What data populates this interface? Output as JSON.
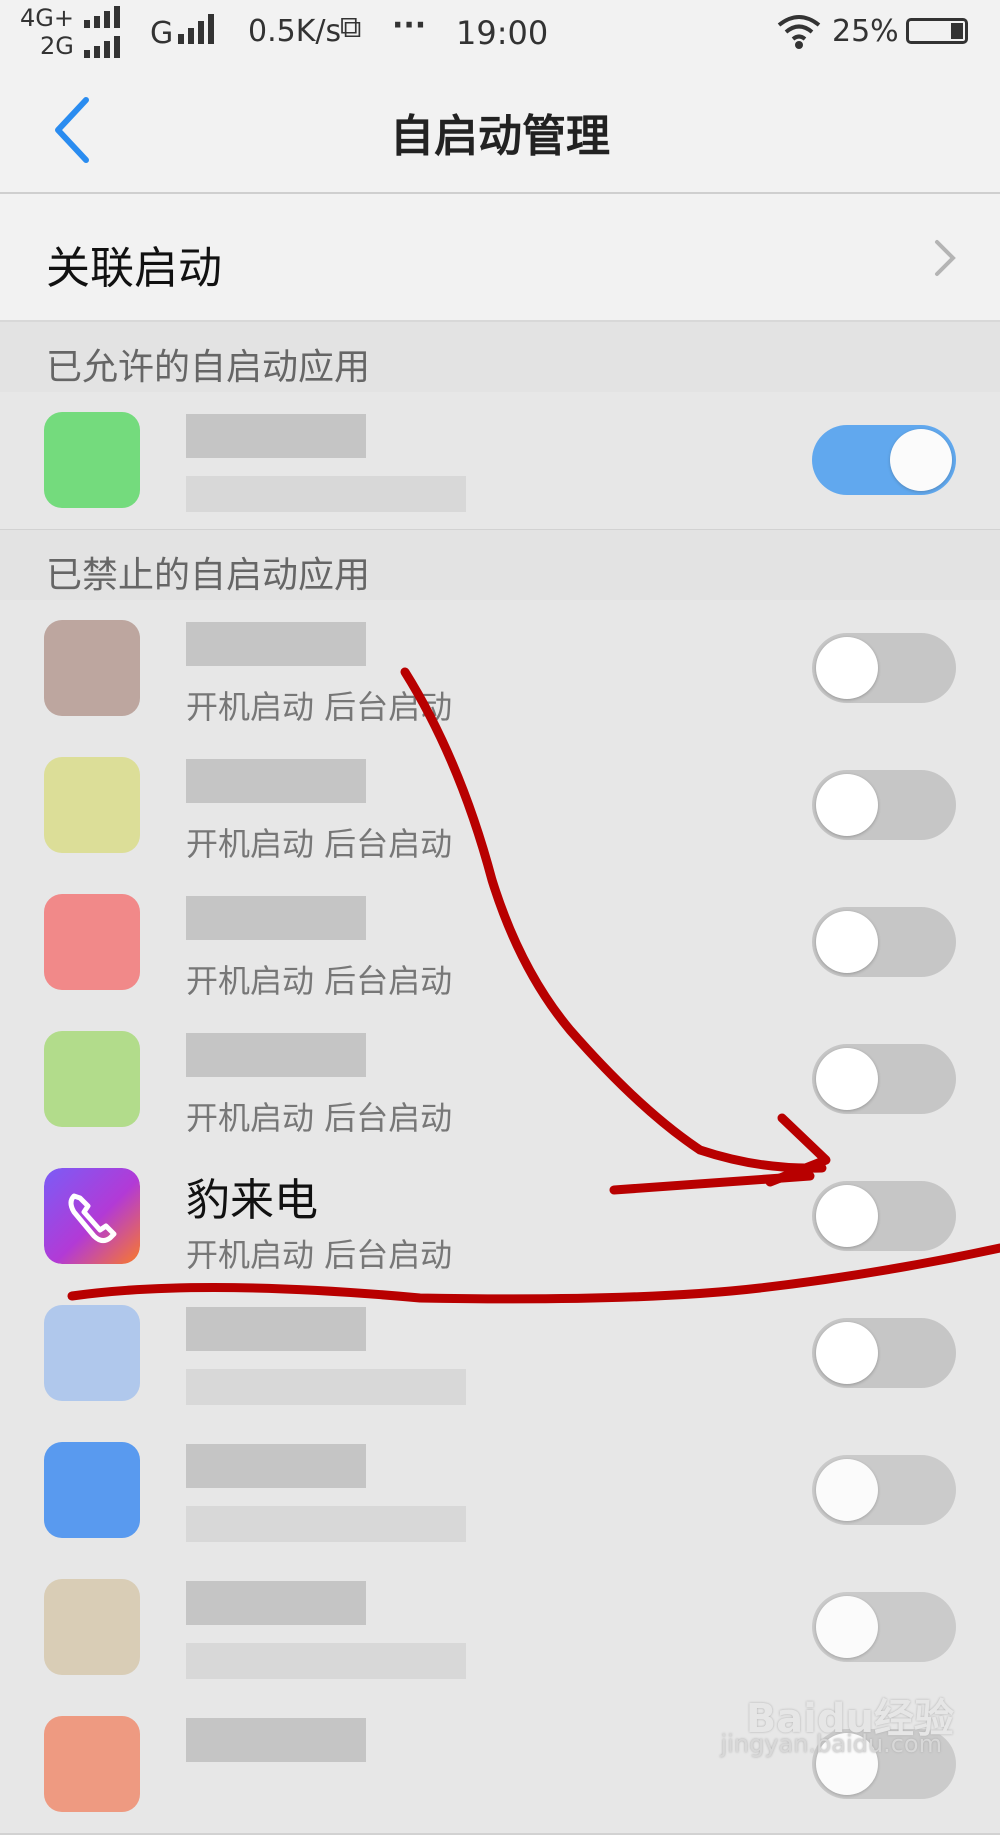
{
  "status_bar": {
    "net1": "4G+",
    "net2": "2G",
    "net3": "G",
    "speed": "0.5K/s",
    "dots": "···",
    "time": "19:00",
    "battery": "25%"
  },
  "header": {
    "title": "自启动管理"
  },
  "associated_launch": {
    "label": "关联启动"
  },
  "sections": {
    "allowed": "已允许的自启动应用",
    "forbidden": "已禁止的自启动应用"
  },
  "apps": [
    {
      "name": "",
      "sub": "",
      "enabled": true,
      "color": "#5fd86a"
    },
    {
      "name": "",
      "sub": "开机启动  后台启动",
      "enabled": false,
      "color": "#b59a92"
    },
    {
      "name": "",
      "sub": "开机启动  后台启动",
      "enabled": false,
      "color": "#d9dc8a"
    },
    {
      "name": "",
      "sub": "开机启动  后台启动",
      "enabled": false,
      "color": "#f27878"
    },
    {
      "name": "",
      "sub": "开机启动  后台启动",
      "enabled": false,
      "color": "#a8d97a"
    },
    {
      "name": "豹来电",
      "sub": "开机启动  后台启动",
      "enabled": false,
      "color": "#8a4df0"
    },
    {
      "name": "",
      "sub": "",
      "enabled": false,
      "color": "#a6c2ec"
    },
    {
      "name": "",
      "sub": "",
      "enabled": false,
      "color": "#3f8cf0"
    },
    {
      "name": "",
      "sub": "",
      "enabled": false,
      "color": "#d6c8ad"
    },
    {
      "name": "",
      "sub": "",
      "enabled": false,
      "color": "#ee8c6e"
    }
  ],
  "watermark": {
    "brand": "Baidu经验",
    "url": "jingyan.baidu.com"
  }
}
